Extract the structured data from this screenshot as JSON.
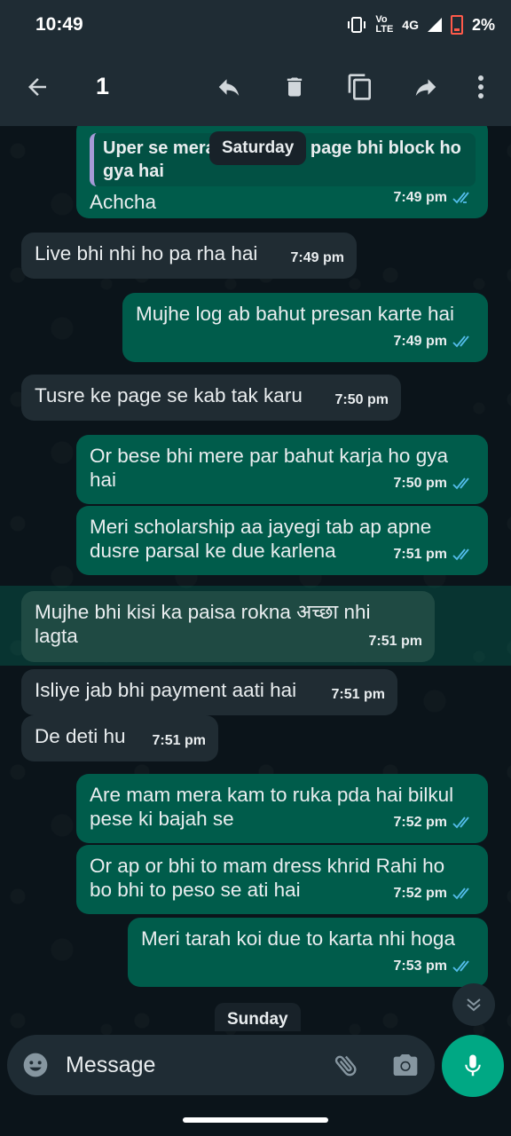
{
  "status_bar": {
    "time": "10:49",
    "volte": "Vo\nLTE",
    "network": "4G",
    "battery": "2%"
  },
  "top_bar": {
    "selected_count": "1"
  },
  "date_chips": {
    "saturday": "Saturday",
    "sunday": "Sunday"
  },
  "messages": [
    {
      "dir": "out",
      "quote": "Uper se mera ... page bhi block ho gya hai",
      "quote_left": "Uper se mera",
      "quote_right": "page bhi block ho",
      "quote_line2": "gya hai",
      "text": "Achcha",
      "time": "7:49 pm"
    },
    {
      "dir": "in",
      "text": "Live bhi nhi ho pa rha hai",
      "time": "7:49 pm"
    },
    {
      "dir": "out",
      "text": "Mujhe log ab bahut presan karte hai",
      "time": "7:49 pm"
    },
    {
      "dir": "in",
      "text": "Tusre ke page se kab tak karu",
      "time": "7:50 pm"
    },
    {
      "dir": "out",
      "text": "Or bese bhi mere par bahut karja ho gya hai",
      "time": "7:50 pm"
    },
    {
      "dir": "out",
      "text": "Meri scholarship aa jayegi tab ap apne dusre parsal ke due karlena",
      "time": "7:51 pm"
    },
    {
      "dir": "in",
      "text": "Mujhe bhi kisi ka paisa rokna अच्छा nhi lagta",
      "time": "7:51 pm",
      "selected": true
    },
    {
      "dir": "in",
      "text": "Isliye jab bhi payment aati hai",
      "time": "7:51 pm"
    },
    {
      "dir": "in",
      "text": "De deti hu",
      "time": "7:51 pm"
    },
    {
      "dir": "out",
      "text": "Are mam mera kam to ruka pda hai bilkul pese ki bajah se",
      "time": "7:52 pm"
    },
    {
      "dir": "out",
      "text": "Or ap or bhi to mam dress khrid Rahi ho bo bhi to peso se ati hai",
      "time": "7:52 pm"
    },
    {
      "dir": "out",
      "text": "Meri tarah koi due to karta nhi hoga",
      "time": "7:53 pm"
    }
  ],
  "composer": {
    "placeholder": "Message"
  },
  "colors": {
    "incoming": "#202c33",
    "outgoing": "#005c4b",
    "accent": "#00a884",
    "tick_read": "#53bdeb"
  },
  "icons": [
    "back-arrow-icon",
    "reply-icon",
    "delete-icon",
    "copy-icon",
    "forward-icon",
    "more-vert-icon",
    "emoji-icon",
    "attach-icon",
    "camera-icon",
    "mic-icon",
    "scroll-down-icon"
  ]
}
